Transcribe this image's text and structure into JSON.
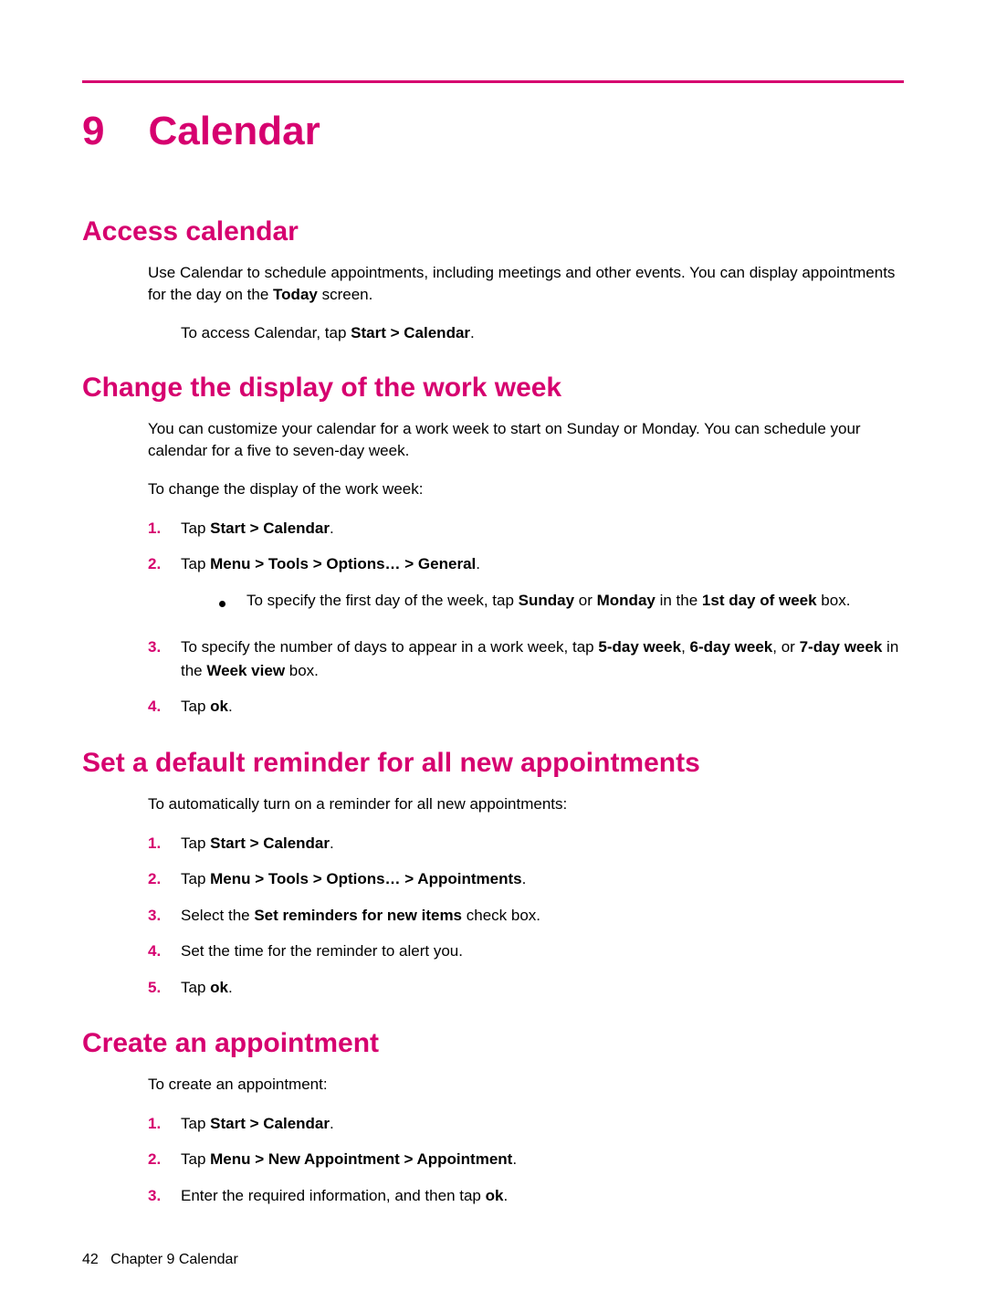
{
  "chapter": {
    "number": "9",
    "title": "Calendar"
  },
  "sections": {
    "access": {
      "heading": "Access calendar",
      "para1_pre": "Use Calendar to schedule appointments, including meetings and other events. You can display appointments for the day on the ",
      "para1_bold": "Today",
      "para1_post": " screen.",
      "para2_pre": "To access Calendar, tap ",
      "para2_bold": "Start > Calendar",
      "para2_post": "."
    },
    "workweek": {
      "heading": "Change the display of the work week",
      "para1": "You can customize your calendar for a work week to start on Sunday or Monday. You can schedule your calendar for a five to seven-day week.",
      "para2": "To change the display of the work week:",
      "steps": {
        "n1": "1.",
        "s1_pre": "Tap ",
        "s1_bold": "Start > Calendar",
        "s1_post": ".",
        "n2": "2.",
        "s2_pre": "Tap ",
        "s2_bold": "Menu > Tools > Options… > General",
        "s2_post": ".",
        "sub_pre": "To specify the first day of the week, tap ",
        "sub_b1": "Sunday",
        "sub_mid1": " or ",
        "sub_b2": "Monday",
        "sub_mid2": " in the ",
        "sub_b3": "1st day of week",
        "sub_post": " box.",
        "n3": "3.",
        "s3_pre": "To specify the number of days to appear in a work week, tap ",
        "s3_b1": "5-day week",
        "s3_mid1": ", ",
        "s3_b2": "6-day week",
        "s3_mid2": ", or ",
        "s3_b3": "7-day week",
        "s3_mid3": " in the ",
        "s3_b4": "Week view",
        "s3_post": " box.",
        "n4": "4.",
        "s4_pre": "Tap ",
        "s4_bold": "ok",
        "s4_post": "."
      }
    },
    "reminder": {
      "heading": "Set a default reminder for all new appointments",
      "para1": "To automatically turn on a reminder for all new appointments:",
      "steps": {
        "n1": "1.",
        "s1_pre": "Tap ",
        "s1_bold": "Start > Calendar",
        "s1_post": ".",
        "n2": "2.",
        "s2_pre": "Tap ",
        "s2_bold": "Menu > Tools > Options… > Appointments",
        "s2_post": ".",
        "n3": "3.",
        "s3_pre": "Select the ",
        "s3_bold": "Set reminders for new items",
        "s3_post": " check box.",
        "n4": "4.",
        "s4": "Set the time for the reminder to alert you.",
        "n5": "5.",
        "s5_pre": "Tap ",
        "s5_bold": "ok",
        "s5_post": "."
      }
    },
    "create": {
      "heading": "Create an appointment",
      "para1": "To create an appointment:",
      "steps": {
        "n1": "1.",
        "s1_pre": "Tap ",
        "s1_bold": "Start > Calendar",
        "s1_post": ".",
        "n2": "2.",
        "s2_pre": "Tap ",
        "s2_bold": "Menu > New Appointment > Appointment",
        "s2_post": ".",
        "n3": "3.",
        "s3_pre": "Enter the required information, and then tap ",
        "s3_bold": "ok",
        "s3_post": "."
      }
    }
  },
  "footer": {
    "page": "42",
    "label": "Chapter 9   Calendar"
  }
}
